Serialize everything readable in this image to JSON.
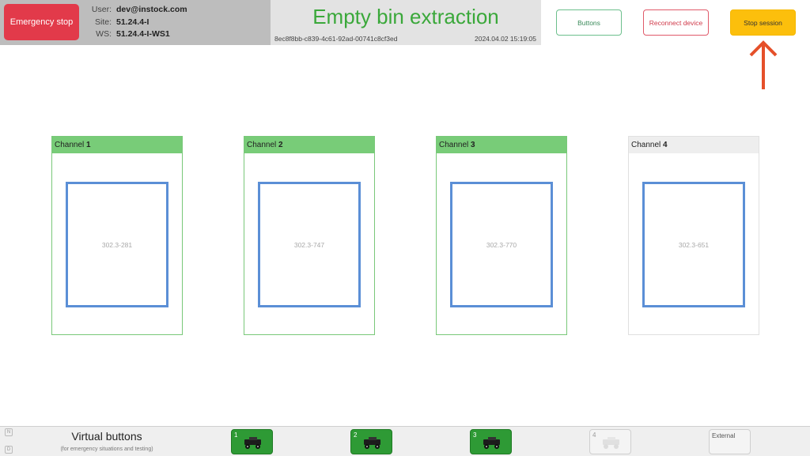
{
  "header": {
    "emergency_stop": "Emergency stop",
    "user_label": "User:",
    "user_value": "dev@instock.com",
    "site_label": "Site:",
    "site_value": "51.24.4-I",
    "ws_label": "WS:",
    "ws_value": "51.24.4-I-WS1",
    "title": "Empty bin extraction",
    "session_id": "8ec8f8bb-c839-4c61-92ad-00741c8cf3ed",
    "timestamp": "2024.04.02 15:19:05",
    "buttons_label": "Buttons",
    "reconnect_label": "Reconnect device",
    "stop_session_label": "Stop session"
  },
  "channels": [
    {
      "label": "Channel",
      "number": "1",
      "bin_id": "302.3-281",
      "active": true
    },
    {
      "label": "Channel",
      "number": "2",
      "bin_id": "302.3-747",
      "active": true
    },
    {
      "label": "Channel",
      "number": "3",
      "bin_id": "302.3-770",
      "active": true
    },
    {
      "label": "Channel",
      "number": "4",
      "bin_id": "302.3-651",
      "active": false
    }
  ],
  "footer": {
    "n_label": "N",
    "d_label": "D",
    "title": "Virtual buttons",
    "subtitle": "(for emergency situations and testing)",
    "buttons": [
      {
        "number": "1",
        "enabled": true
      },
      {
        "number": "2",
        "enabled": true
      },
      {
        "number": "3",
        "enabled": true
      },
      {
        "number": "4",
        "enabled": false
      }
    ],
    "external_label": "External"
  },
  "colors": {
    "accent_green": "#3aa83a",
    "channel_active": "#78cc78",
    "bin_border": "#5b8fd6",
    "emergency": "#e23a4a",
    "stop_session": "#fcbf0c",
    "arrow": "#e5502a"
  }
}
